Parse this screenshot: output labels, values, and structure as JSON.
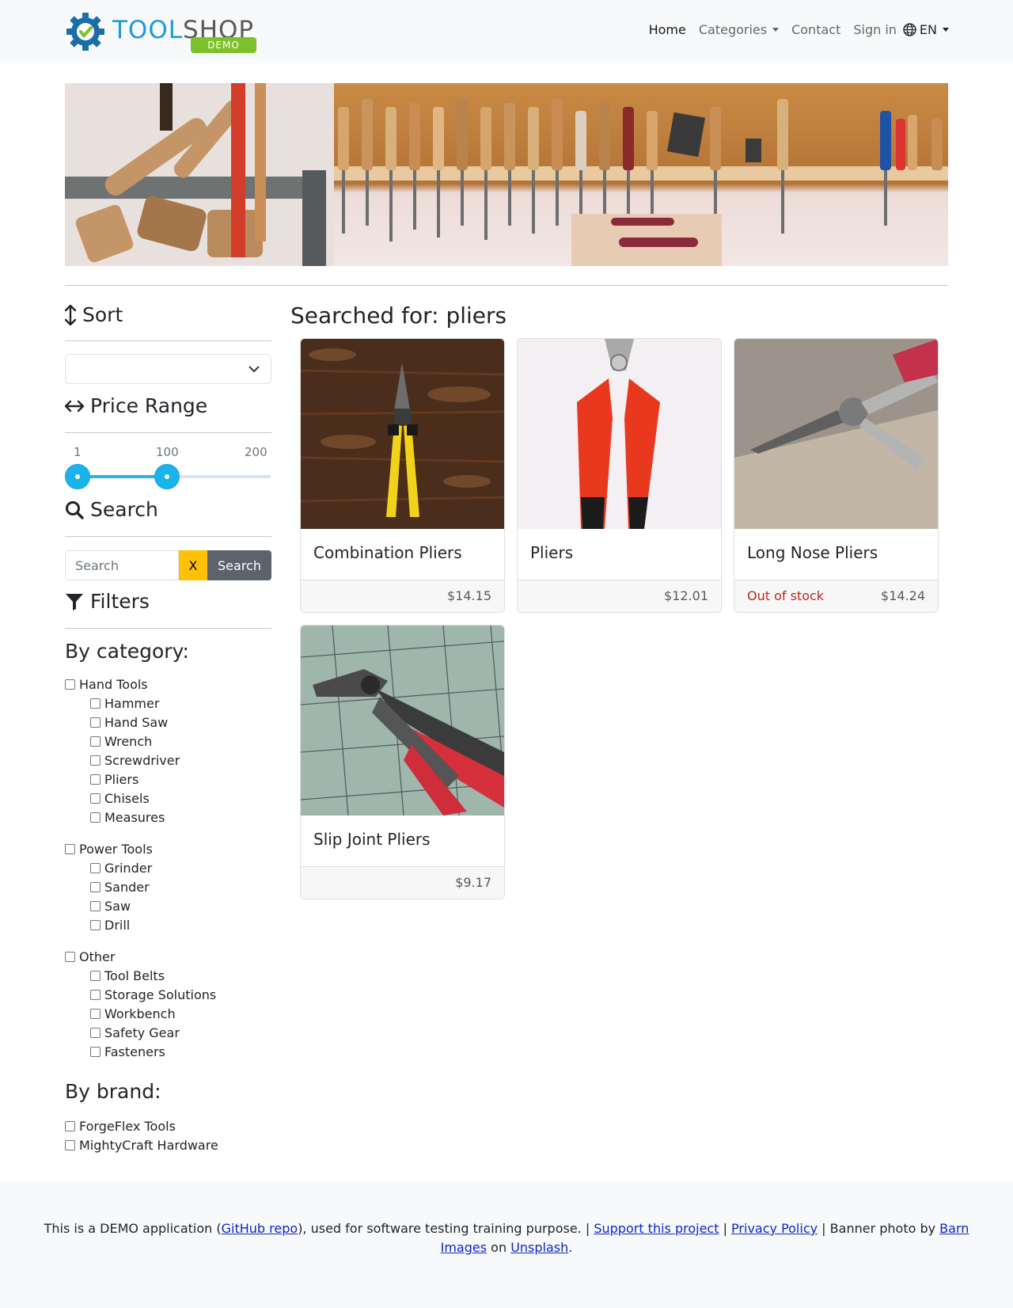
{
  "brand": {
    "logo_main_a": "TOOL",
    "logo_main_b": "SHOP",
    "logo_badge": "DEMO"
  },
  "nav": {
    "home": "Home",
    "categories": "Categories",
    "contact": "Contact",
    "sign_in": "Sign in",
    "language": "EN"
  },
  "sidebar": {
    "sort_heading": "Sort",
    "sort_value": "",
    "price_heading": "Price Range",
    "price_min_label": "1",
    "price_mid_label": "100",
    "price_max_label": "200",
    "price_range": {
      "min": 1,
      "max": 200,
      "low": 1,
      "high": 100
    },
    "search_heading": "Search",
    "search_placeholder": "Search",
    "search_value": "",
    "clear_label": "X",
    "search_button": "Search",
    "filters_heading": "Filters",
    "by_category": "By category:",
    "by_brand": "By brand:",
    "categories": [
      {
        "label": "Hand Tools",
        "children": [
          "Hammer",
          "Hand Saw",
          "Wrench",
          "Screwdriver",
          "Pliers",
          "Chisels",
          "Measures"
        ]
      },
      {
        "label": "Power Tools",
        "children": [
          "Grinder",
          "Sander",
          "Saw",
          "Drill"
        ]
      },
      {
        "label": "Other",
        "children": [
          "Tool Belts",
          "Storage Solutions",
          "Workbench",
          "Safety Gear",
          "Fasteners"
        ]
      }
    ],
    "brands": [
      "ForgeFlex Tools",
      "MightyCraft Hardware"
    ]
  },
  "main": {
    "title": "Searched for: pliers",
    "products": [
      {
        "name": "Combination Pliers",
        "price": "$14.15",
        "stock": ""
      },
      {
        "name": "Pliers",
        "price": "$12.01",
        "stock": ""
      },
      {
        "name": "Long Nose Pliers",
        "price": "$14.24",
        "stock": "Out of stock"
      },
      {
        "name": "Slip Joint Pliers",
        "price": "$9.17",
        "stock": ""
      }
    ]
  },
  "footer": {
    "t1": "This is a DEMO application (",
    "github": "GitHub repo",
    "t2": "), used for software testing training purpose. | ",
    "support": "Support this project",
    "t3": " | ",
    "privacy": "Privacy Policy",
    "t4": " | Banner photo by ",
    "barn": "Barn Images",
    "t5": " on ",
    "unsplash": "Unsplash",
    "t6": "."
  },
  "colors": {
    "accent": "#1ab3ea",
    "clear_button": "#ffc107",
    "search_button": "#5c636a",
    "out_of_stock": "#c1271d"
  }
}
